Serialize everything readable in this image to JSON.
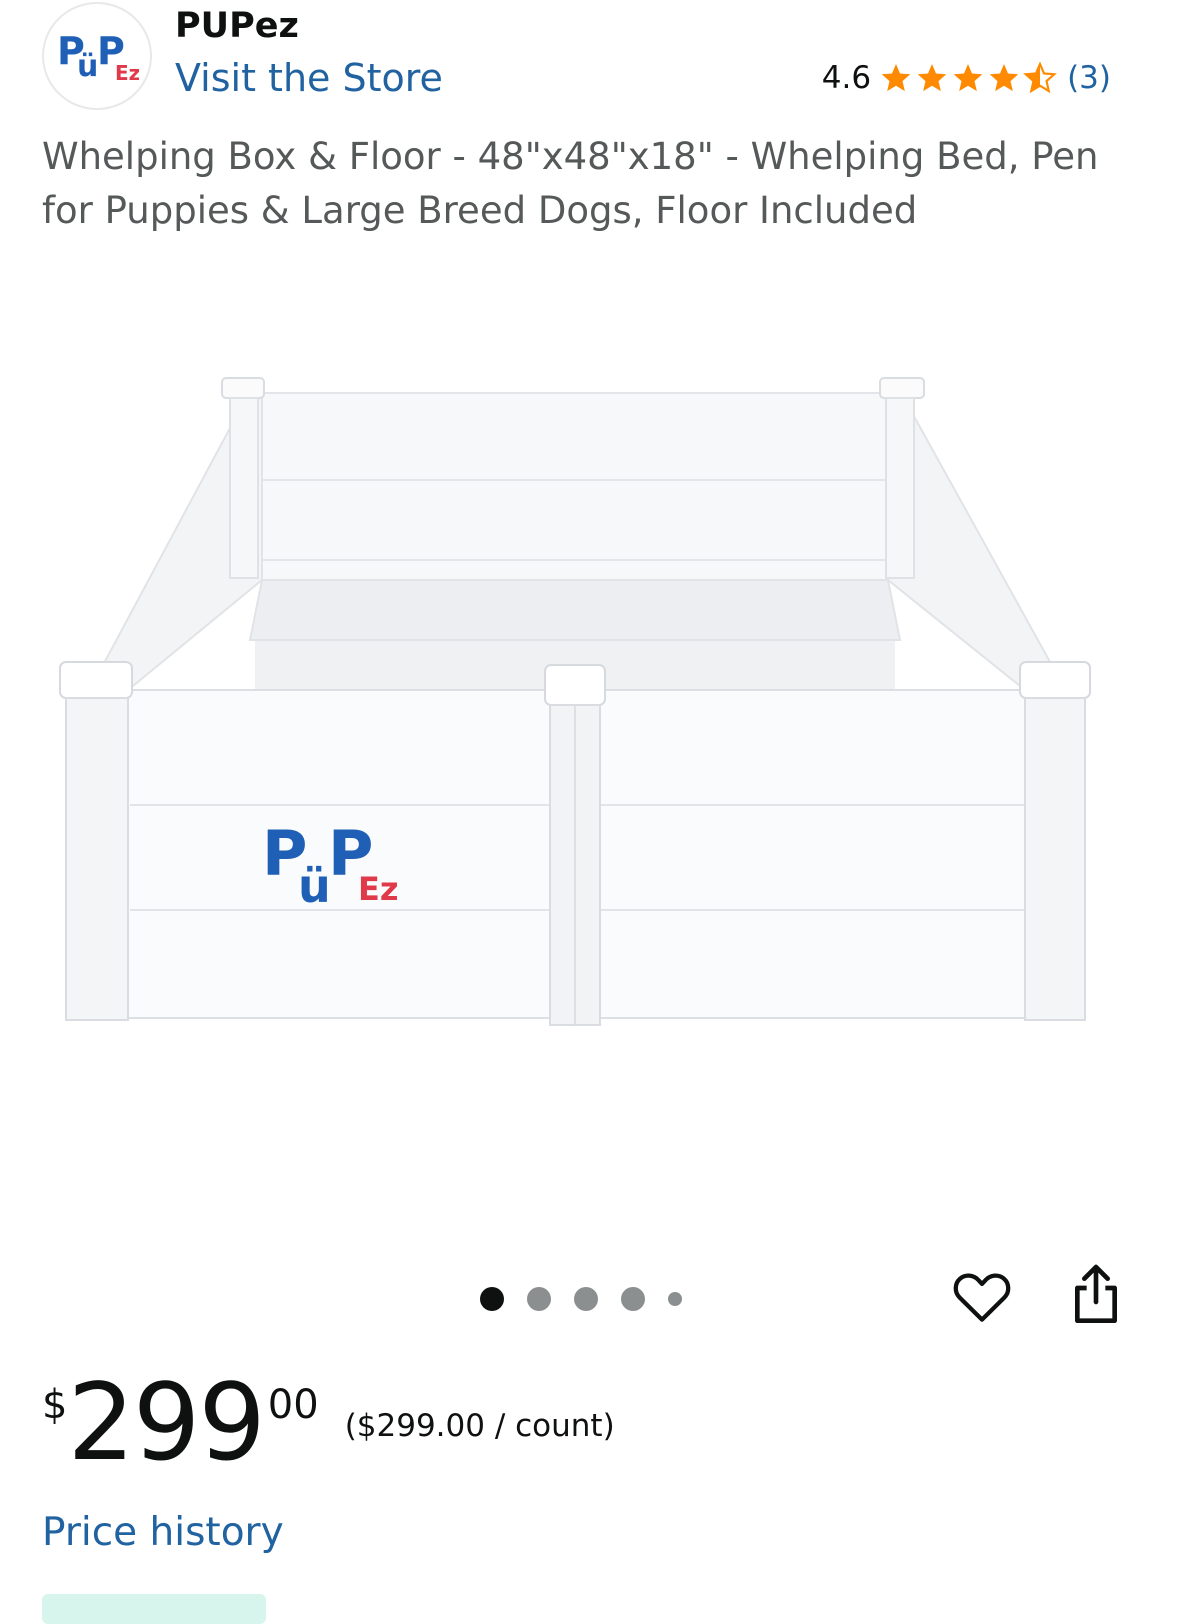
{
  "store": {
    "logo_text": "PUPez",
    "brand_name": "PUPez",
    "visit_label": "Visit the Store",
    "rating_value": "4.6",
    "rating_stars": 4.6,
    "rating_count": "(3)"
  },
  "product": {
    "title": "Whelping Box & Floor - 48\"x48\"x18\" - Whelping Bed, Pen for Puppies & Large Breed Dogs, Floor Included",
    "image_logo_text": "PUPez",
    "image_count": 5,
    "active_image": 1,
    "wishlist_icon": "heart-icon",
    "share_icon": "share-icon"
  },
  "price": {
    "currency": "$",
    "whole": "299",
    "fraction": "00",
    "unit_price": "($299.00 / count)",
    "history_label": "Price history"
  },
  "colors": {
    "link": "#2162a1",
    "star": "#ff8a00",
    "text": "#0f1111",
    "muted": "#565959",
    "logo_blue": "#1f5fb5",
    "logo_red": "#e0394a"
  }
}
